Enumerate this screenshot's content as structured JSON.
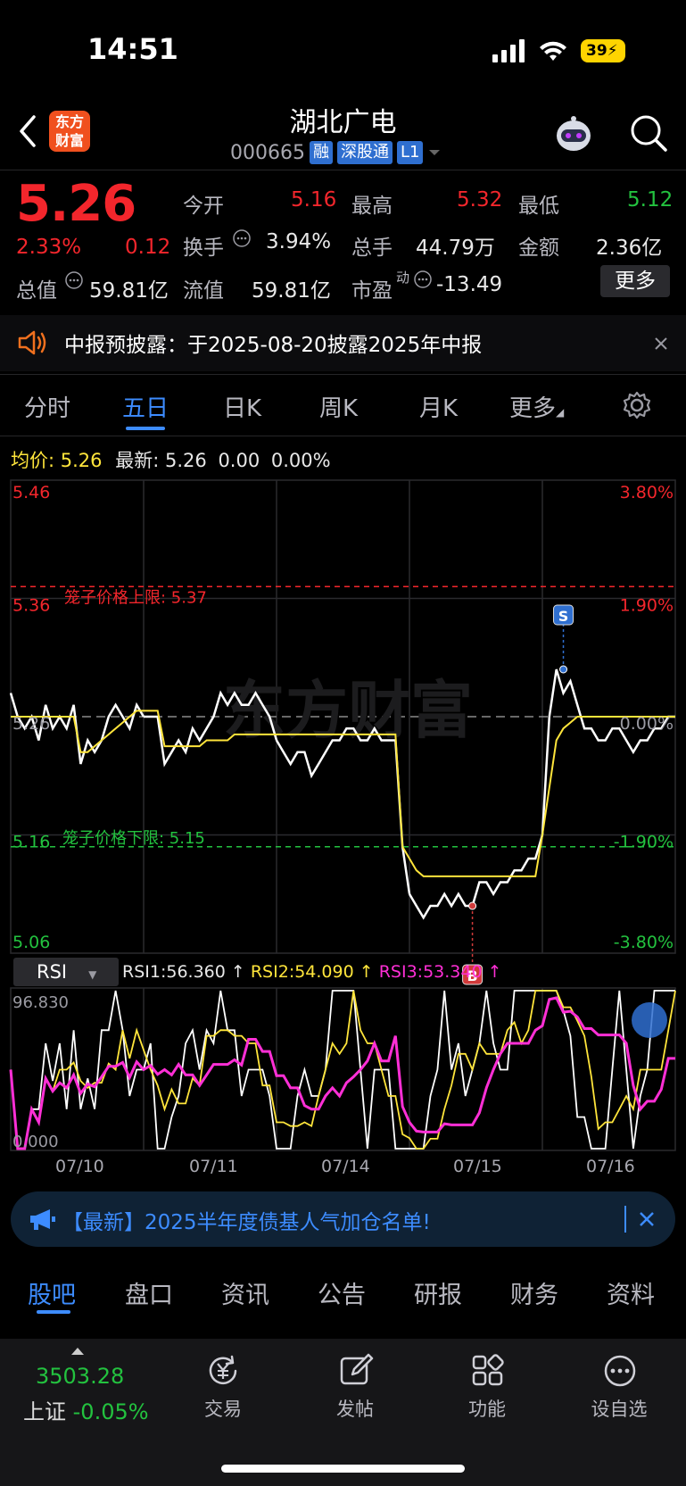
{
  "status": {
    "time": "14:51",
    "battery": "39"
  },
  "header": {
    "logo_line1": "东方",
    "logo_line2": "财富",
    "title": "湖北广电",
    "code": "000665",
    "tags": [
      "融",
      "深股通",
      "L1"
    ]
  },
  "quote": {
    "price": "5.26",
    "change_pct": "2.33%",
    "change": "0.12",
    "fields": [
      {
        "label": "今开",
        "value": "5.16",
        "color": "#f3262c"
      },
      {
        "label": "最高",
        "value": "5.32",
        "color": "#f3262c"
      },
      {
        "label": "最低",
        "value": "5.12",
        "color": "#23c23f"
      },
      {
        "label": "换手",
        "value": "3.94%",
        "color": "#e8e8e8"
      },
      {
        "label": "总手",
        "value": "44.79万",
        "color": "#e8e8e8"
      },
      {
        "label": "金额",
        "value": "2.36亿",
        "color": "#e8e8e8"
      }
    ],
    "total_cap_label": "总值",
    "total_cap": "59.81亿",
    "float_cap_label": "流值",
    "float_cap": "59.81亿",
    "pe_label": "市盈",
    "pe_sup": "动",
    "pe": "-13.49",
    "more": "更多"
  },
  "notice": {
    "text": "中报预披露：于2025-08-20披露2025年中报"
  },
  "chart_tabs": [
    "分时",
    "五日",
    "日K",
    "周K",
    "月K",
    "更多"
  ],
  "chart_tab_active": 1,
  "chart_info": {
    "avg_label": "均价:",
    "avg": "5.26",
    "latest_label": "最新:",
    "latest": "5.26",
    "chg": "0.00",
    "chg_pct": "0.00%"
  },
  "chart_data": {
    "type": "line",
    "ylim": [
      5.06,
      5.46
    ],
    "y_ticks_left": [
      "5.46",
      "5.36",
      "5.26",
      "5.16",
      "5.06"
    ],
    "y_ticks_right": [
      "3.80%",
      "1.90%",
      "0.00%",
      "-1.90%",
      "-3.80%"
    ],
    "x_categories": [
      "07/10",
      "07/11",
      "07/14",
      "07/15",
      "07/16"
    ],
    "upper_limit": {
      "label": "笼子价格上限:",
      "value": 5.37
    },
    "lower_limit": {
      "label": "笼子价格下限:",
      "value": 5.15
    },
    "series": [
      {
        "color": "#ffffff",
        "points": [
          5.28,
          5.26,
          5.25,
          5.26,
          5.24,
          5.27,
          5.25,
          5.26,
          5.25,
          5.27,
          5.22,
          5.24,
          5.23,
          5.24,
          5.26,
          5.27,
          5.26,
          5.25,
          5.27,
          5.26,
          5.26,
          5.26,
          5.22,
          5.23,
          5.24,
          5.23,
          5.25,
          5.24,
          5.25,
          5.26,
          5.28,
          5.27,
          5.28,
          5.27,
          5.27,
          5.28,
          5.27,
          5.26,
          5.24,
          5.23,
          5.22,
          5.23,
          5.23,
          5.21,
          5.22,
          5.23,
          5.24,
          5.24,
          5.25,
          5.25,
          5.24,
          5.24,
          5.25,
          5.24,
          5.24,
          5.24,
          5.15,
          5.11,
          5.1,
          5.09,
          5.1,
          5.1,
          5.11,
          5.1,
          5.11,
          5.1,
          5.1,
          5.12,
          5.12,
          5.11,
          5.12,
          5.12,
          5.13,
          5.13,
          5.14,
          5.14,
          5.16,
          5.26,
          5.3,
          5.28,
          5.29,
          5.27,
          5.25,
          5.25,
          5.24,
          5.24,
          5.25,
          5.25,
          5.24,
          5.23,
          5.24,
          5.24,
          5.25,
          5.25,
          5.26,
          5.26
        ]
      },
      {
        "color": "#ffe53b",
        "points": [
          5.26,
          5.26,
          5.26,
          5.26,
          5.26,
          5.26,
          5.26,
          5.26,
          5.26,
          5.26,
          5.23,
          5.23,
          5.235,
          5.24,
          5.245,
          5.25,
          5.255,
          5.26,
          5.265,
          5.265,
          5.265,
          5.265,
          5.235,
          5.235,
          5.235,
          5.235,
          5.235,
          5.235,
          5.24,
          5.24,
          5.24,
          5.24,
          5.245,
          5.245,
          5.245,
          5.245,
          5.245,
          5.245,
          5.245,
          5.245,
          5.245,
          5.245,
          5.245,
          5.245,
          5.245,
          5.245,
          5.245,
          5.245,
          5.245,
          5.245,
          5.245,
          5.245,
          5.245,
          5.245,
          5.245,
          5.245,
          5.15,
          5.14,
          5.13,
          5.125,
          5.125,
          5.125,
          5.125,
          5.125,
          5.125,
          5.125,
          5.125,
          5.125,
          5.125,
          5.125,
          5.125,
          5.125,
          5.125,
          5.125,
          5.125,
          5.125,
          5.16,
          5.2,
          5.24,
          5.25,
          5.255,
          5.26,
          5.26,
          5.26,
          5.26,
          5.26,
          5.26,
          5.26,
          5.26,
          5.26,
          5.26,
          5.26,
          5.26,
          5.26,
          5.26,
          5.26
        ]
      }
    ],
    "markers": [
      {
        "label": "S",
        "at": 79,
        "price": 5.3
      },
      {
        "label": "B",
        "at": 66,
        "price": 5.1
      }
    ],
    "watermark": "东方财富"
  },
  "rsi": {
    "selector": "RSI",
    "rsi1": "RSI1:56.360",
    "rsi2": "RSI2:54.090",
    "rsi3": "RSI3:53.340",
    "arrow": "↑",
    "max": "96.830",
    "min": "0.000"
  },
  "banner": {
    "text": "【最新】2025半年度债基人气加仓名单!"
  },
  "bottom_tabs": [
    "股吧",
    "盘口",
    "资讯",
    "公告",
    "研报",
    "财务",
    "资料"
  ],
  "nav": {
    "index_value": "3503.28",
    "index_name": "上证",
    "index_change": "-0.05%",
    "items": [
      "交易",
      "发帖",
      "功能",
      "设自选"
    ]
  }
}
